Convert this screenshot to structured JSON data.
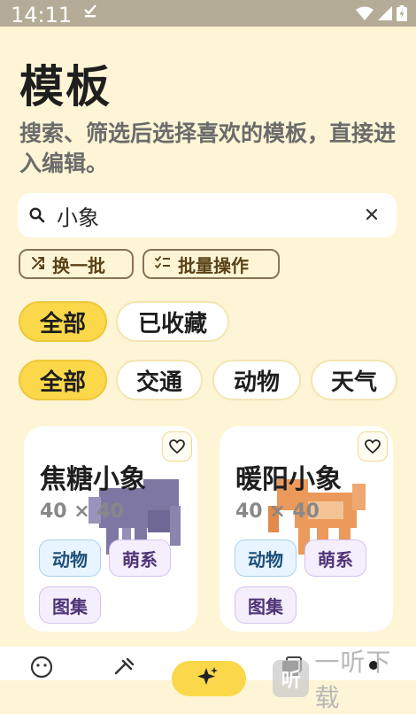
{
  "status_bar": {
    "time": "14:11"
  },
  "page": {
    "title": "模板",
    "subtitle": "搜索、筛选后选择喜欢的模板，直接进入编辑。"
  },
  "search": {
    "value": "小象",
    "placeholder": ""
  },
  "actions": {
    "shuffle_label": "换一批",
    "batch_label": "批量操作"
  },
  "scope_filters": [
    {
      "label": "全部",
      "selected": true
    },
    {
      "label": "已收藏",
      "selected": false
    }
  ],
  "category_filters": [
    {
      "label": "全部",
      "selected": true
    },
    {
      "label": "交通",
      "selected": false
    },
    {
      "label": "动物",
      "selected": false
    },
    {
      "label": "天气",
      "selected": false
    }
  ],
  "templates": [
    {
      "name": "焦糖小象",
      "size": "40 × 40",
      "tags": [
        "动物",
        "萌系",
        "图集"
      ],
      "art_color": "#7E77A4"
    },
    {
      "name": "暖阳小象",
      "size": "40 × 40",
      "tags": [
        "动物",
        "萌系",
        "图集"
      ],
      "art_color": "#EB9A5C"
    }
  ],
  "watermark": {
    "logo_text": "听",
    "text": "一听下载"
  },
  "colors": {
    "background": "#FEF5D6",
    "accent": "#FAD84A",
    "status_bar": "#B4AC96"
  }
}
